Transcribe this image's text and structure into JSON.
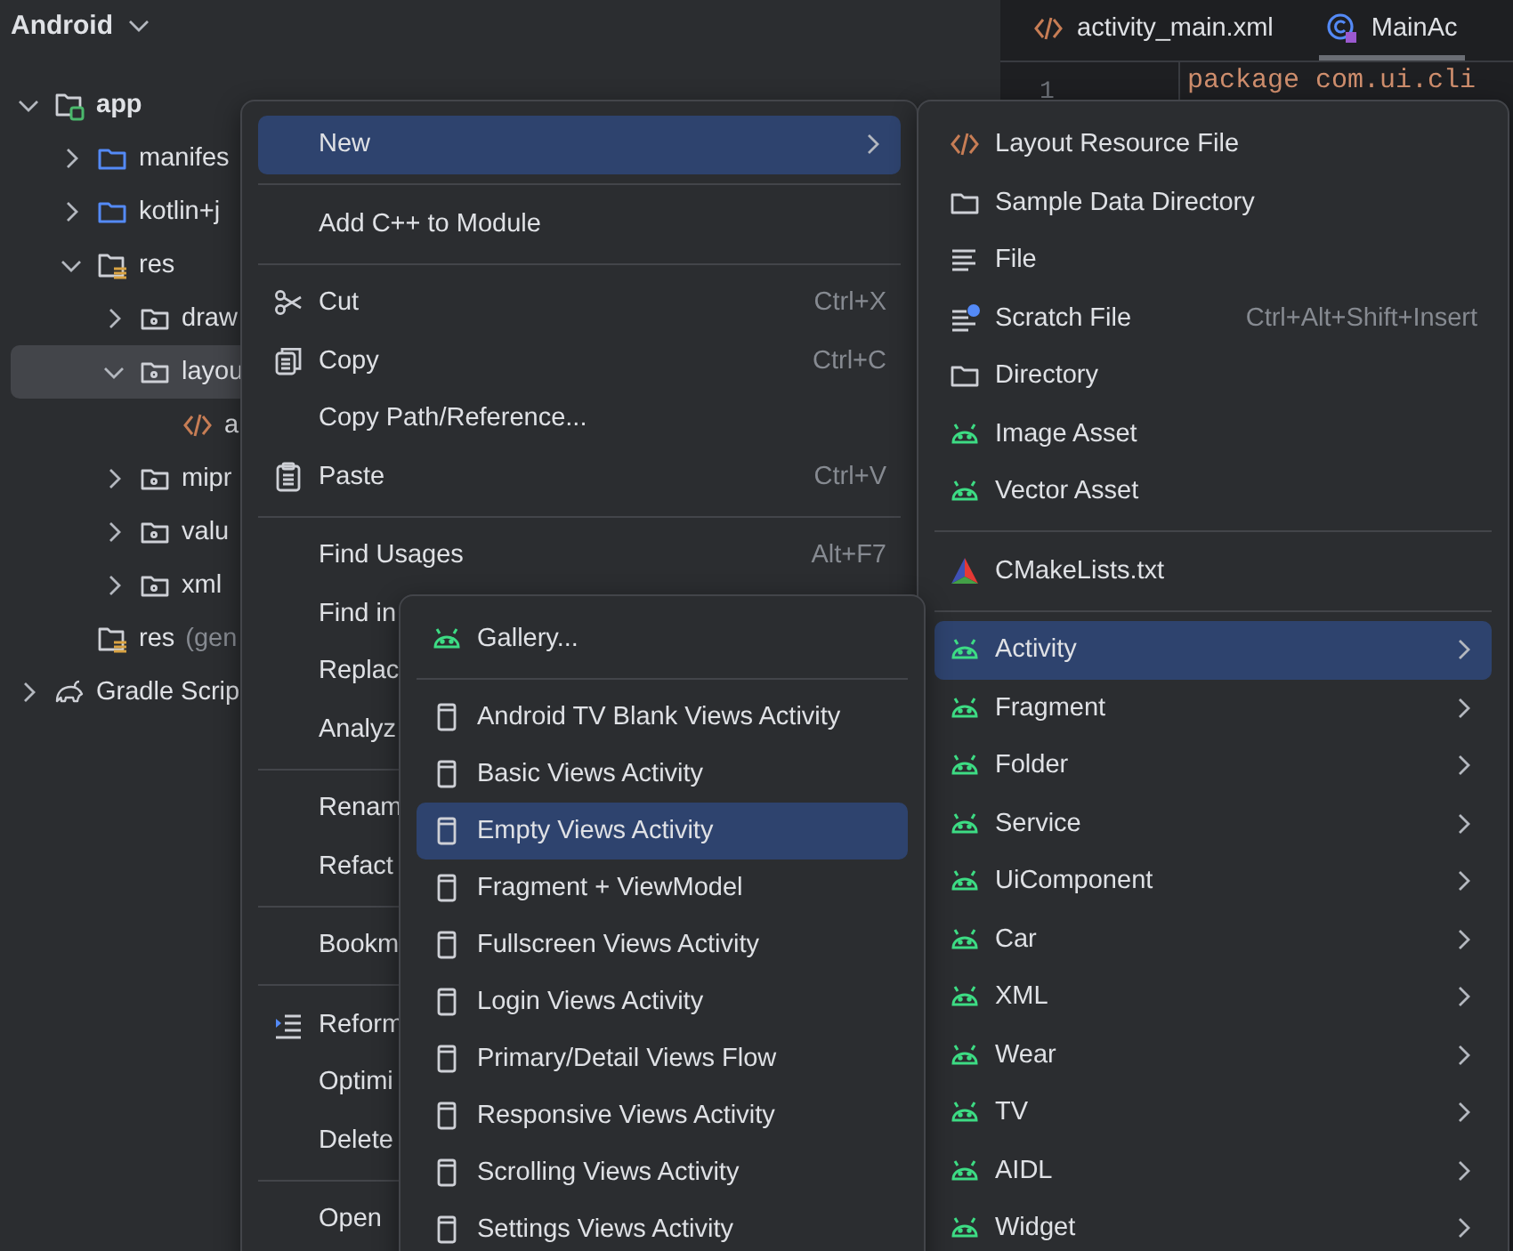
{
  "project_view": {
    "title": "Android"
  },
  "tree": [
    {
      "label": "app",
      "kind": "module",
      "expanded": true,
      "selected": false,
      "children": [
        {
          "label": "manifes",
          "kind": "source-folder",
          "expanded": false,
          "selected": false
        },
        {
          "label": "kotlin+j",
          "kind": "source-folder",
          "expanded": false,
          "selected": false
        },
        {
          "label": "res",
          "kind": "resource-root",
          "expanded": true,
          "selected": false,
          "children": [
            {
              "label": "draw",
              "kind": "package",
              "expanded": false,
              "selected": false
            },
            {
              "label": "layou",
              "kind": "package",
              "expanded": true,
              "selected": true,
              "children": [
                {
                  "label": "a",
                  "kind": "xml-file",
                  "selected": false
                }
              ]
            },
            {
              "label": "mipr",
              "kind": "package",
              "expanded": false,
              "selected": false
            },
            {
              "label": "valu",
              "kind": "package",
              "expanded": false,
              "selected": false
            },
            {
              "label": "xml",
              "kind": "package",
              "expanded": false,
              "selected": false
            }
          ]
        },
        {
          "label": "res",
          "note": "(gen",
          "kind": "resource-root",
          "selected": false
        }
      ]
    },
    {
      "label": "Gradle Scrip",
      "kind": "gradle",
      "expanded": false,
      "selected": false
    }
  ],
  "editor": {
    "tabs": [
      {
        "label": "activity_main.xml",
        "kind": "xml",
        "selected": false
      },
      {
        "label": "MainAc",
        "kind": "kotlin-class",
        "selected": true
      }
    ],
    "lines": [
      {
        "number": "1",
        "code": "package com.ui.cli"
      }
    ]
  },
  "context_menu": {
    "items": [
      {
        "kind": "plain",
        "label": "New",
        "submenu": true,
        "selected": true
      },
      {
        "kind": "separator"
      },
      {
        "kind": "plain",
        "label": "Add C++ to Module",
        "submenu": false,
        "selected": false
      },
      {
        "kind": "separator"
      },
      {
        "kind": "scissors",
        "label": "Cut",
        "shortcut": "Ctrl+X",
        "submenu": false,
        "selected": false
      },
      {
        "kind": "copy",
        "label": "Copy",
        "shortcut": "Ctrl+C",
        "submenu": false,
        "selected": false
      },
      {
        "kind": "plain",
        "label": "Copy Path/Reference...",
        "submenu": false,
        "selected": false
      },
      {
        "kind": "paste",
        "label": "Paste",
        "shortcut": "Ctrl+V",
        "submenu": false,
        "selected": false
      },
      {
        "kind": "separator"
      },
      {
        "kind": "plain",
        "label": "Find Usages",
        "shortcut": "Alt+F7",
        "submenu": false,
        "selected": false
      },
      {
        "kind": "plain",
        "label": "Find in",
        "selected": false
      },
      {
        "kind": "plain",
        "label": "Replac",
        "selected": false
      },
      {
        "kind": "plain",
        "label": "Analyz",
        "selected": false
      },
      {
        "kind": "separator"
      },
      {
        "kind": "plain",
        "label": "Renam",
        "selected": false
      },
      {
        "kind": "plain",
        "label": "Refact",
        "selected": false
      },
      {
        "kind": "separator"
      },
      {
        "kind": "plain",
        "label": "Bookm",
        "selected": false
      },
      {
        "kind": "separator"
      },
      {
        "kind": "reformat",
        "label": "Reform",
        "selected": false
      },
      {
        "kind": "plain",
        "label": "Optimi",
        "selected": false
      },
      {
        "kind": "plain",
        "label": "Delete",
        "selected": false
      },
      {
        "kind": "separator"
      },
      {
        "kind": "plain",
        "label": "Open",
        "selected": false
      }
    ]
  },
  "new_menu": {
    "items": [
      {
        "kind": "code",
        "label": "Layout Resource File",
        "submenu": false,
        "selected": false
      },
      {
        "kind": "folder",
        "label": "Sample Data Directory",
        "submenu": false,
        "selected": false
      },
      {
        "kind": "lines",
        "label": "File",
        "submenu": false,
        "selected": false
      },
      {
        "kind": "scratch",
        "label": "Scratch File",
        "shortcut": "Ctrl+Alt+Shift+Insert",
        "submenu": false,
        "selected": false
      },
      {
        "kind": "folder",
        "label": "Directory",
        "submenu": false,
        "selected": false
      },
      {
        "kind": "android",
        "label": "Image Asset",
        "submenu": false,
        "selected": false
      },
      {
        "kind": "android",
        "label": "Vector Asset",
        "submenu": false,
        "selected": false
      },
      {
        "kind": "separator"
      },
      {
        "kind": "cmake",
        "label": "CMakeLists.txt",
        "submenu": false,
        "selected": false
      },
      {
        "kind": "separator"
      },
      {
        "kind": "android",
        "label": "Activity",
        "submenu": true,
        "selected": true
      },
      {
        "kind": "android",
        "label": "Fragment",
        "submenu": true,
        "selected": false
      },
      {
        "kind": "android",
        "label": "Folder",
        "submenu": true,
        "selected": false
      },
      {
        "kind": "android",
        "label": "Service",
        "submenu": true,
        "selected": false
      },
      {
        "kind": "android",
        "label": "UiComponent",
        "submenu": true,
        "selected": false
      },
      {
        "kind": "android",
        "label": "Car",
        "submenu": true,
        "selected": false
      },
      {
        "kind": "android",
        "label": "XML",
        "submenu": true,
        "selected": false
      },
      {
        "kind": "android",
        "label": "Wear",
        "submenu": true,
        "selected": false
      },
      {
        "kind": "android",
        "label": "TV",
        "submenu": true,
        "selected": false
      },
      {
        "kind": "android",
        "label": "AIDL",
        "submenu": true,
        "selected": false
      },
      {
        "kind": "android",
        "label": "Widget",
        "submenu": true,
        "selected": false
      }
    ]
  },
  "activity_menu": {
    "items": [
      {
        "kind": "android",
        "label": "Gallery...",
        "submenu": false,
        "selected": false
      },
      {
        "kind": "separator"
      },
      {
        "kind": "device",
        "label": "Android TV Blank Views Activity",
        "submenu": false,
        "selected": false
      },
      {
        "kind": "device",
        "label": "Basic Views Activity",
        "submenu": false,
        "selected": false
      },
      {
        "kind": "device",
        "label": "Empty Views Activity",
        "submenu": false,
        "selected": true
      },
      {
        "kind": "device",
        "label": "Fragment + ViewModel",
        "submenu": false,
        "selected": false
      },
      {
        "kind": "device",
        "label": "Fullscreen Views Activity",
        "submenu": false,
        "selected": false
      },
      {
        "kind": "device",
        "label": "Login Views Activity",
        "submenu": false,
        "selected": false
      },
      {
        "kind": "device",
        "label": "Primary/Detail Views Flow",
        "submenu": false,
        "selected": false
      },
      {
        "kind": "device",
        "label": "Responsive Views Activity",
        "submenu": false,
        "selected": false
      },
      {
        "kind": "device",
        "label": "Scrolling Views Activity",
        "submenu": false,
        "selected": false
      },
      {
        "kind": "device",
        "label": "Settings Views Activity",
        "submenu": false,
        "selected": false
      }
    ]
  }
}
